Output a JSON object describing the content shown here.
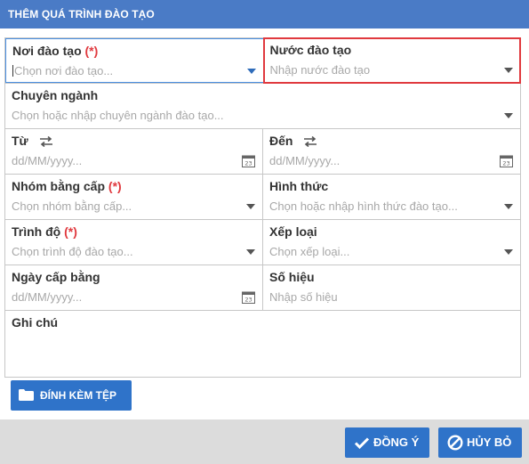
{
  "dialog": {
    "title": "THÊM QUÁ TRÌNH ĐÀO TẠO"
  },
  "form": {
    "noi_dao_tao": {
      "label": "Nơi đào tạo",
      "required": "(*)",
      "placeholder": "Chọn nơi đào tạo..."
    },
    "nuoc_dao_tao": {
      "label": "Nước đào tạo",
      "placeholder": "Nhập nước đào tạo"
    },
    "chuyen_nganh": {
      "label": "Chuyên ngành",
      "placeholder": "Chọn hoặc nhập chuyên ngành đào tạo..."
    },
    "tu": {
      "label": "Từ",
      "placeholder": "dd/MM/yyyy..."
    },
    "den": {
      "label": "Đến",
      "placeholder": "dd/MM/yyyy..."
    },
    "nhom_bang_cap": {
      "label": "Nhóm bằng cấp",
      "required": "(*)",
      "placeholder": "Chọn nhóm bằng cấp..."
    },
    "hinh_thuc": {
      "label": "Hình thức",
      "placeholder": "Chọn hoặc nhập hình thức đào tạo..."
    },
    "trinh_do": {
      "label": "Trình độ",
      "required": "(*)",
      "placeholder": "Chọn trình độ đào tạo..."
    },
    "xep_loai": {
      "label": "Xếp loại",
      "placeholder": "Chọn xếp loại..."
    },
    "ngay_cap_bang": {
      "label": "Ngày cấp bằng",
      "placeholder": "dd/MM/yyyy..."
    },
    "so_hieu": {
      "label": "Số hiệu",
      "placeholder": "Nhập số hiệu"
    },
    "ghi_chu": {
      "label": "Ghi chú"
    }
  },
  "calendar_day": "23",
  "buttons": {
    "attach": "ĐÍNH KÈM TỆP",
    "ok": "ĐỒNG Ý",
    "cancel": "HỦY BỎ"
  },
  "colors": {
    "accent": "#2f73c9",
    "titlebar": "#4a7bc6",
    "required": "#e0393e",
    "highlight": "#e0393e"
  },
  "icons": [
    "caret-down-icon",
    "swap-arrows-icon",
    "calendar-icon",
    "folder-icon",
    "check-icon",
    "cancel-icon"
  ]
}
